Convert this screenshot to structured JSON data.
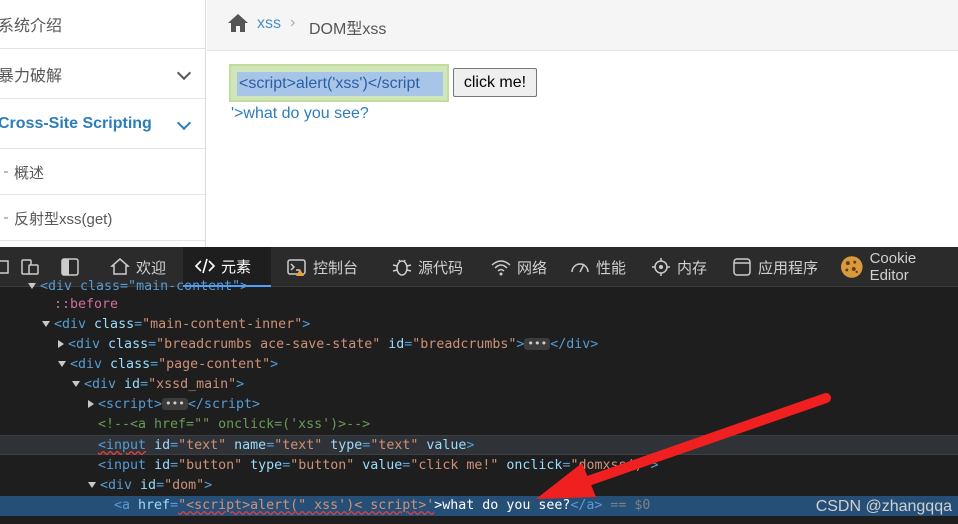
{
  "sidebar": {
    "items": [
      {
        "label": "系统介绍"
      },
      {
        "label": "暴力破解"
      },
      {
        "label": "Cross-Site Scripting"
      }
    ],
    "subitems": [
      {
        "label": "概述"
      },
      {
        "label": "反射型xss(get)"
      }
    ]
  },
  "breadcrumb": {
    "section": "xss",
    "separator": "›",
    "current": "DOM型xss"
  },
  "main": {
    "text_input_value": "<script>alert('xss')</script",
    "button_label": "click me!",
    "dom_link_text": "'>what do you see?"
  },
  "devtools": {
    "tools": [
      {
        "label": "欢迎",
        "icon": "home-icon"
      },
      {
        "label": "元素",
        "icon": "code-icon",
        "active": true
      },
      {
        "label": "控制台",
        "icon": "console-icon"
      },
      {
        "label": "源代码",
        "icon": "bug-icon"
      },
      {
        "label": "网络",
        "icon": "wifi-icon"
      },
      {
        "label": "性能",
        "icon": "gauge-icon"
      },
      {
        "label": "内存",
        "icon": "chip-icon"
      },
      {
        "label": "应用程序",
        "icon": "app-icon"
      },
      {
        "label": "Cookie Editor",
        "icon": "cookie-icon"
      }
    ],
    "tree": {
      "l0": "<div class=\"main-content\">",
      "l1_pseudo": "::before",
      "l2_tag": "<div",
      "l2_attr": "class",
      "l2_val": "\"main-content-inner\"",
      "l3_attr1": "class",
      "l3_val1": "\"breadcrumbs ace-save-state\"",
      "l3_attr2": "id",
      "l3_val2": "\"breadcrumbs\"",
      "l4_attr": "class",
      "l4_val": "\"page-content\"",
      "l5_attr": "id",
      "l5_val": "\"xssd_main\"",
      "l7_comment": "<!--<a href=\"\" onclick=('xss')>-->",
      "l8_attr1": "id",
      "l8_val1": "\"text\"",
      "l8_attr2": "name",
      "l8_val2": "\"text\"",
      "l8_attr3": "type",
      "l8_val3": "\"text\"",
      "l8_attr4": "value",
      "l9_attr1": "id",
      "l9_val1": "\"button\"",
      "l9_attr2": "type",
      "l9_val2": "\"button\"",
      "l9_attr3": "value",
      "l9_val3": "\"click me!\"",
      "l9_attr4": "onclick",
      "l9_val4": "\"domxss()\"",
      "l10_attr": "id",
      "l10_val": "\"dom\"",
      "l11_attr": "href",
      "l11_val": "\"<script>alert(\" xss')< script>'",
      "l11_text": ">what do you see?",
      "l11_dollar": "== $0"
    }
  },
  "watermark": "CSDN @zhangqqa"
}
